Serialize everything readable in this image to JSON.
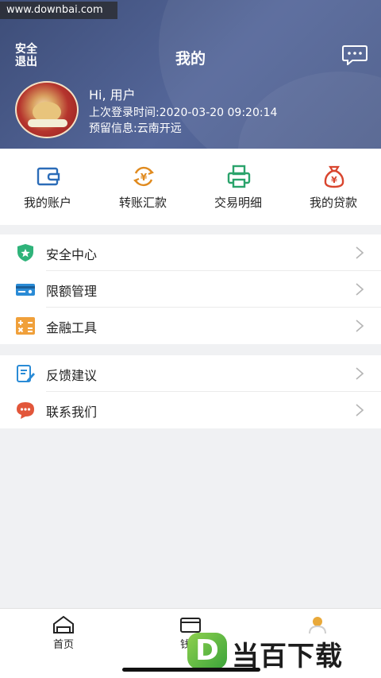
{
  "watermark": "www.downbai.com",
  "header": {
    "logout_label": "安全退出",
    "title": "我的",
    "greeting": "Hi, 用户",
    "last_login": "上次登录时间:2020-03-20 09:20:14",
    "reserved_info": "预留信息:云南开远"
  },
  "quick_actions": [
    {
      "label": "我的账户",
      "icon": "wallet-icon",
      "color": "#2b6cb8"
    },
    {
      "label": "转账汇款",
      "icon": "transfer-icon",
      "color": "#e08a1e"
    },
    {
      "label": "交易明细",
      "icon": "printer-icon",
      "color": "#2aa36b"
    },
    {
      "label": "我的贷款",
      "icon": "money-bag-icon",
      "color": "#d9452e"
    }
  ],
  "menu_group1": [
    {
      "label": "安全中心",
      "icon": "shield-icon",
      "color": "#2fb37a"
    },
    {
      "label": "限额管理",
      "icon": "card-icon",
      "color": "#2a8bd6"
    },
    {
      "label": "金融工具",
      "icon": "calculator-icon",
      "color": "#f0a03a"
    }
  ],
  "menu_group2": [
    {
      "label": "反馈建议",
      "icon": "feedback-icon",
      "color": "#2a8bd6"
    },
    {
      "label": "联系我们",
      "icon": "chat-icon",
      "color": "#e2563a"
    }
  ],
  "tabbar": {
    "home": "首页",
    "wallet": "钱包"
  },
  "brand": {
    "letter": "D",
    "text": "当百下载"
  }
}
